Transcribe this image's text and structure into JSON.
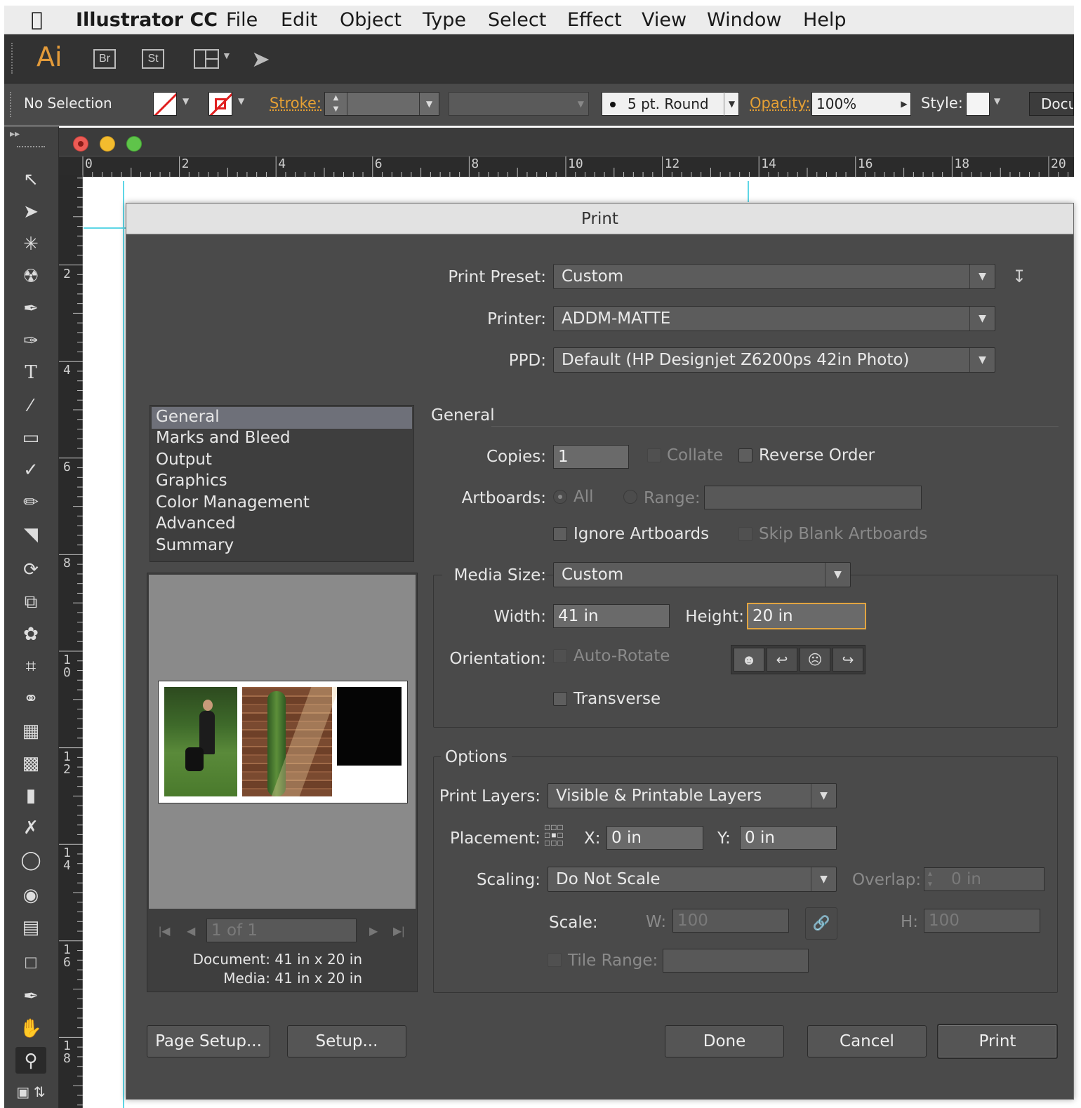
{
  "menubar": {
    "app": "Illustrator CC",
    "items": [
      "File",
      "Edit",
      "Object",
      "Type",
      "Select",
      "Effect",
      "View",
      "Window",
      "Help"
    ]
  },
  "apptool": {
    "logo": "Ai",
    "br": "Br",
    "st": "St"
  },
  "ctrlbar": {
    "selection": "No Selection",
    "stroke_label": "Stroke:",
    "brush": "5 pt. Round",
    "opacity_label": "Opacity:",
    "opacity_value": "100%",
    "style_label": "Style:",
    "doc_tab": "Docu"
  },
  "ruler": {
    "h": [
      "0",
      "2",
      "4",
      "6",
      "8",
      "10",
      "12",
      "14",
      "16",
      "18",
      "20"
    ],
    "v": [
      "2",
      "4",
      "6",
      "8",
      "1\n0",
      "1\n2",
      "1\n4",
      "1\n6",
      "1\n8"
    ]
  },
  "dialog": {
    "title": "Print",
    "preset_label": "Print Preset:",
    "preset_value": "Custom",
    "printer_label": "Printer:",
    "printer_value": "ADDM-MATTE",
    "ppd_label": "PPD:",
    "ppd_value": "Default (HP Designjet Z6200ps 42in Photo)",
    "nav": [
      "General",
      "Marks and Bleed",
      "Output",
      "Graphics",
      "Color Management",
      "Advanced",
      "Summary"
    ],
    "section_general": "General",
    "copies_label": "Copies:",
    "copies_value": "1",
    "collate": "Collate",
    "reverse_order": "Reverse Order",
    "artboards_label": "Artboards:",
    "all": "All",
    "range": "Range:",
    "ignore_artboards": "Ignore Artboards",
    "skip_blank": "Skip Blank Artboards",
    "media_size_label": "Media Size:",
    "media_size_value": "Custom",
    "width_label": "Width:",
    "width_value": "41 in",
    "height_label": "Height:",
    "height_value": "20 in",
    "orientation_label": "Orientation:",
    "auto_rotate": "Auto-Rotate",
    "transverse": "Transverse",
    "options_label": "Options",
    "print_layers_label": "Print Layers:",
    "print_layers_value": "Visible & Printable Layers",
    "placement_label": "Placement:",
    "x_label": "X:",
    "x_value": "0 in",
    "y_label": "Y:",
    "y_value": "0 in",
    "scaling_label": "Scaling:",
    "scaling_value": "Do Not Scale",
    "overlap_label": "Overlap:",
    "overlap_value": "0 in",
    "scale_label": "Scale:",
    "w_label": "W:",
    "w_value": "100",
    "h_label": "H:",
    "h_value": "100",
    "tile_range": "Tile Range:",
    "pager": "1 of 1",
    "document_info": "Document: 41 in x 20 in",
    "media_info": "Media: 41 in x 20 in",
    "btn_page_setup": "Page Setup...",
    "btn_setup": "Setup...",
    "btn_done": "Done",
    "btn_cancel": "Cancel",
    "btn_print": "Print"
  }
}
